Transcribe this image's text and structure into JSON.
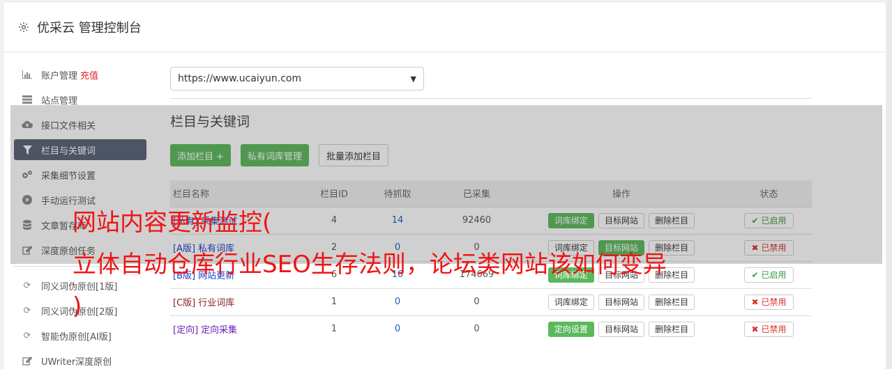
{
  "header": {
    "title": "优采云 管理控制台",
    "icon": "gear-icon"
  },
  "sidebar": {
    "items": [
      {
        "label": "账户管理",
        "extra": "充值",
        "icon": "bar-chart-icon"
      },
      {
        "label": "站点管理",
        "icon": "server-icon"
      },
      {
        "label": "接口文件相关",
        "icon": "cloud-upload-icon"
      },
      {
        "label": "栏目与关键词",
        "icon": "filter-icon",
        "active": true
      },
      {
        "label": "采集细节设置",
        "icon": "gears-icon"
      },
      {
        "label": "手动运行测试",
        "icon": "play-circle-icon"
      },
      {
        "label": "文章暂存库",
        "icon": "database-icon"
      },
      {
        "label": "深度原创任务",
        "icon": "edit-icon"
      },
      {
        "label": "同义词伪原创[1版]",
        "icon": "refresh-icon"
      },
      {
        "label": "同义词伪原创[2版]",
        "icon": "refresh-icon"
      },
      {
        "label": "智能伪原创[AI版]",
        "icon": "refresh-icon"
      },
      {
        "label": "UWriter深度原创",
        "icon": "edit-icon"
      }
    ]
  },
  "site_select": {
    "value": "https://www.ucaiyun.com"
  },
  "section": {
    "title": "栏目与关键词",
    "add_button": "添加栏目 +",
    "private_lib_button": "私有词库管理",
    "batch_add_button": "批量添加栏目"
  },
  "table": {
    "headers": [
      "栏目名称",
      "栏目ID",
      "待抓取",
      "已采集",
      "操作",
      "状态"
    ],
    "rows": [
      {
        "tag": "[私有]",
        "name": "采集测试",
        "id": "4",
        "pending": "14",
        "collected": "92460",
        "ops": [
          "词库绑定",
          "目标网站",
          "删除栏目"
        ],
        "status": "已启用"
      },
      {
        "tag": "[A版]",
        "name": "私有词库",
        "id": "2",
        "pending": "0",
        "collected": "0",
        "ops": [
          "词库绑定",
          "目标网站",
          "删除栏目"
        ],
        "status": "已禁用"
      },
      {
        "tag": "[B版]",
        "name": "网站更新",
        "id": "6",
        "pending": "10",
        "collected": "174669",
        "ops": [
          "词库绑定",
          "目标网站",
          "删除栏目"
        ],
        "status": "已启用"
      },
      {
        "tag": "[C版]",
        "name": "行业词库",
        "id": "1",
        "pending": "0",
        "collected": "0",
        "ops": [
          "词库绑定",
          "目标网站",
          "删除栏目"
        ],
        "status": "已禁用"
      },
      {
        "tag": "[定向]",
        "name": "定向采集",
        "id": "1",
        "pending": "0",
        "collected": "0",
        "ops": [
          "定向设置",
          "目标网站",
          "删除栏目"
        ],
        "status": "已禁用"
      }
    ]
  },
  "watermark": {
    "line1": "网站内容更新监控(",
    "line2": "立体自动仓库行业SEO生存法则，论坛类网站该如何变异",
    "line3": ")"
  },
  "colors": {
    "active_bg": "#586074",
    "green": "#5cb85c",
    "red": "#f01414"
  }
}
